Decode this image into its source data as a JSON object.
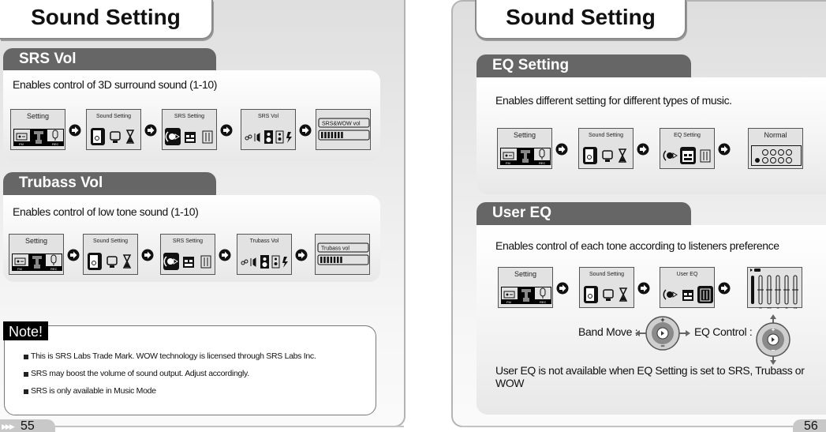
{
  "left_page": {
    "title": "Sound Setting",
    "page_number": "55",
    "sections": [
      {
        "header": "SRS Vol",
        "description": "Enables control of 3D surround sound (1-10)",
        "screens": [
          {
            "caption": "Setting",
            "icons": [
              "radio-icon",
              "settings-tool-icon",
              "microphone-icon"
            ],
            "labels": [
              "FM",
              "",
              "REC"
            ]
          },
          {
            "caption": "Sound Setting",
            "icons": [
              "speaker-note-icon",
              "monitor-icon",
              "hourglass-icon"
            ]
          },
          {
            "caption": "SRS Setting",
            "icons": [
              "srs-sound-icon",
              "calendar-icon",
              "equalizer-icon"
            ]
          },
          {
            "caption": "SRS  Vol",
            "icons": [
              "satellite-icon",
              "sound-wave-icon",
              "speaker-icon",
              "speaker-small-icon",
              "bolt-icon"
            ]
          },
          {
            "caption": "SRS&WOW   vol",
            "level_bars": 7
          }
        ]
      },
      {
        "header": "Trubass Vol",
        "description": "Enables control of low tone sound (1-10)",
        "screens": [
          {
            "caption": "Setting",
            "icons": [
              "radio-icon",
              "settings-tool-icon",
              "microphone-icon"
            ],
            "labels": [
              "FM",
              "",
              "REC"
            ]
          },
          {
            "caption": "Sound Setting",
            "icons": [
              "speaker-note-icon",
              "monitor-icon",
              "hourglass-icon"
            ]
          },
          {
            "caption": "SRS Setting",
            "icons": [
              "srs-sound-icon",
              "calendar-icon",
              "equalizer-icon"
            ]
          },
          {
            "caption": "Trubass  Vol",
            "icons": [
              "satellite-icon",
              "sound-wave-icon",
              "speaker-small-icon",
              "speaker-icon",
              "bolt-icon"
            ]
          },
          {
            "caption": "Trubass     vol",
            "level_bars": 7
          }
        ]
      }
    ],
    "note": {
      "label": "Note!",
      "items": [
        "This is SRS Labs Trade Mark. WOW technology is licensed through SRS Labs Inc.",
        "SRS may boost the volume of sound output. Adjust accordingly.",
        "SRS is only available in Music Mode"
      ]
    }
  },
  "right_page": {
    "title": "Sound Setting",
    "page_number": "56",
    "sections": [
      {
        "header": "EQ Setting",
        "description": "Enables different setting for different types of music.",
        "screens": [
          {
            "caption": "Setting",
            "labels": [
              "FM",
              "",
              "REC"
            ]
          },
          {
            "caption": "Sound Setting"
          },
          {
            "caption": "EQ Setting"
          },
          {
            "caption": "Normal"
          }
        ]
      },
      {
        "header": "User EQ",
        "description": "Enables control of each tone according to listeners preference",
        "screens": [
          {
            "caption": "Setting",
            "labels": [
              "FM",
              "",
              "REC"
            ]
          },
          {
            "caption": "Sound Setting"
          },
          {
            "caption": "User EQ"
          },
          {
            "caption": "",
            "eq_bands": [
              "60",
              "250",
              "1k",
              "4k",
              "14k"
            ]
          }
        ],
        "controls": {
          "band_move_label": "Band Move :",
          "eq_control_label": "EQ Control :",
          "plus": "+",
          "minus": "−"
        },
        "footer": "User EQ is not available when EQ Setting is set to SRS, Trubass or WOW"
      }
    ]
  },
  "colors": {
    "section_tab": "#666666",
    "frame_border": "#b4b4b4",
    "note_label_bg": "#000000",
    "page_bg_top": "#dedede"
  }
}
